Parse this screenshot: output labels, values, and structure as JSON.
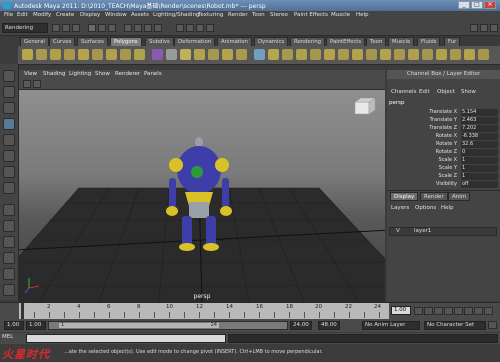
{
  "window": {
    "title": "Autodesk Maya 2011: D:\\2010_TEACH\\Maya基础\\Render\\scenes\\Robot.mb* --- persp",
    "min": "_",
    "max": "□",
    "close": "✕"
  },
  "menubar": [
    "File",
    "Edit",
    "Modify",
    "Create",
    "Display",
    "Window",
    "Assets",
    "Lighting/Shading",
    "Texturing",
    "Render",
    "Toon",
    "Stereo",
    "Paint Effects",
    "Muscle",
    "Help"
  ],
  "status_line": {
    "mode": "Rendering"
  },
  "shelf_tabs": [
    "General",
    "Curves",
    "Surfaces",
    "Polygons",
    "Subdivs",
    "Deformation",
    "Animation",
    "Dynamics",
    "Rendering",
    "PaintEffects",
    "Toon",
    "Muscle",
    "Fluids",
    "Fur"
  ],
  "active_shelf_tab": "Polygons",
  "viewport": {
    "menu": [
      "View",
      "Shading",
      "Lighting",
      "Show",
      "Renderer",
      "Panels"
    ],
    "camera_label": "persp"
  },
  "channel_box": {
    "header": "Channel Box / Layer Editor",
    "menu": [
      "Channels",
      "Edit",
      "Object",
      "Show"
    ],
    "object": "persp",
    "attributes": [
      {
        "name": "Translate X",
        "value": "5.154"
      },
      {
        "name": "Translate Y",
        "value": "2.463"
      },
      {
        "name": "Translate Z",
        "value": "7.202"
      },
      {
        "name": "Rotate X",
        "value": "-6.338"
      },
      {
        "name": "Rotate Y",
        "value": "32.6"
      },
      {
        "name": "Rotate Z",
        "value": "0"
      },
      {
        "name": "Scale X",
        "value": "1"
      },
      {
        "name": "Scale Y",
        "value": "1"
      },
      {
        "name": "Scale Z",
        "value": "1"
      },
      {
        "name": "Visibility",
        "value": "off"
      }
    ],
    "layer_tabs": [
      "Display",
      "Render",
      "Anim"
    ],
    "layer_menu": [
      "Layers",
      "Options",
      "Help"
    ],
    "layer": {
      "visible": "V",
      "name": "layer1"
    }
  },
  "time_slider": {
    "ticks": [
      "2",
      "4",
      "6",
      "8",
      "10",
      "12",
      "14",
      "16",
      "18",
      "20",
      "22",
      "24"
    ],
    "current_frame": "1.00"
  },
  "range_slider": {
    "start": "1.00",
    "range_start": "1.00",
    "range_left_label": "1",
    "range_right_label": "24",
    "end": "24.00",
    "anim_end": "48.00",
    "anim_layer": "No Anim Layer",
    "char_set": "No Character Set"
  },
  "command_line": {
    "label": "MEL"
  },
  "help_line": {
    "text": "...ate the selected object(s). Use edit mode to change pivot (INSERT). Ctrl+LMB to move perpendicular.",
    "watermark": "火星时代"
  },
  "colors": {
    "robot_body": "#3e3ea8",
    "robot_yellow": "#d8c228",
    "robot_grey": "#9aa0a8",
    "robot_green": "#2f9a3a"
  }
}
